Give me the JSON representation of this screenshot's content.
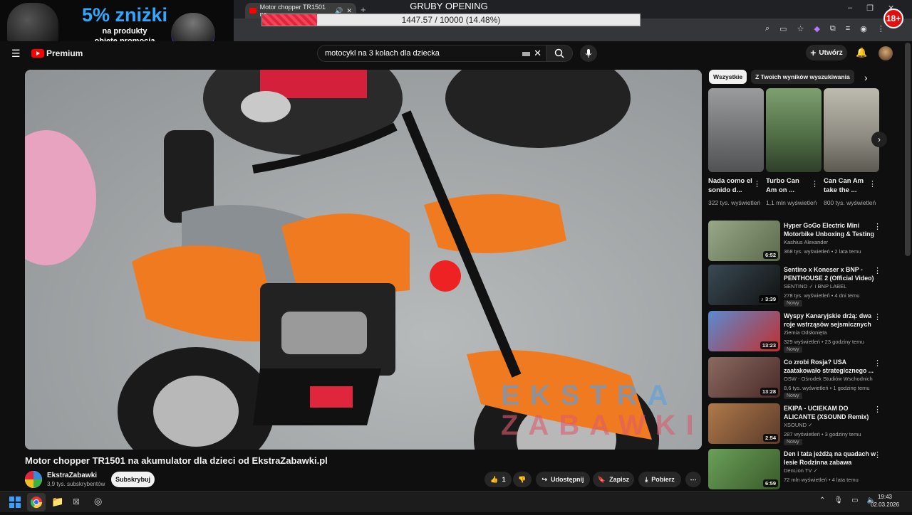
{
  "browser": {
    "tab_title": "Motor chopper TR1501 na",
    "overlay_title": "GRUBY OPENING",
    "progress_text": "1447.57 / 10000 (14.48%)",
    "progress_fraction": 0.1448,
    "badge": "18+",
    "window_controls": [
      "–",
      "❐",
      "✕"
    ]
  },
  "ad": {
    "headline": "5% zniżki",
    "line1": "na produkty",
    "line2": "objęte promocją"
  },
  "youtube": {
    "logo_text": "Premium",
    "search_query": "motocykl na 3 kolach dla dziecka",
    "create_label": "Utwórz"
  },
  "video": {
    "title": "Motor chopper TR1501 na akumulator dla dzieci od EkstraZabawki.pl",
    "watermark_line1": "EKSTRA",
    "watermark_line2": "ZABAWKI",
    "channel": "EkstraZabawki",
    "subscribers": "3,9 tys. subskrybentów",
    "subscribe_label": "Subskrybuj",
    "likes": "1",
    "share_label": "Udostępnij",
    "save_label": "Zapisz",
    "download_label": "Pobierz"
  },
  "chips": [
    "Wszystkie",
    "Z Twoich wyników wyszukiwania"
  ],
  "shorts": [
    {
      "title": "Nada como el sonido d...",
      "views": "322 tys. wyświetleń",
      "thumb_color": "#6d6f70"
    },
    {
      "title": "Turbo Can Am on ...",
      "views": "1,1 mln wyświetleń",
      "thumb_color": "#4e6b44"
    },
    {
      "title": "Can Can Am take the ...",
      "views": "800 tys. wyświetleń",
      "thumb_color": "#8c8a80"
    }
  ],
  "recommendations": [
    {
      "title": "Hyper GoGo Electric Mini Motorbike Unboxing & Testing ...",
      "channel": "Kashius Alexander",
      "meta": "368 tys. wyświetleń • 2 lata temu",
      "duration": "6:52",
      "new": "",
      "thumb_color": "#7a8a6a"
    },
    {
      "title": "Sentino x Koneser x BNP - PENTHOUSE 2 (Official Video)",
      "channel": "SENTINO ✓ i BNP LABEL",
      "meta": "278 tys. wyświetleń • 4 dni temu",
      "duration": "♪ 3:39",
      "new": "Nowy",
      "thumb_color": "#1f2a33"
    },
    {
      "title": "Wyspy Kanaryjskie drżą: dwa roje wstrząsów sejsmicznych i...",
      "channel": "Ziemia Odsłonięta",
      "meta": "329 wyświetleń • 23 godziny temu",
      "duration": "13:23",
      "new": "Nowy",
      "thumb_color": "#3a6aa8"
    },
    {
      "title": "Co zrobi Rosja? USA zaatakowało strategicznego ...",
      "channel": "OSW - Ośrodek Studiów Wschodnich",
      "meta": "8,6 tys. wyświetleń • 1 godzinę temu",
      "duration": "13:28",
      "new": "Nowy",
      "thumb_color": "#6b5048"
    },
    {
      "title": "EKIPA - UCIEKAM DO ALICANTE (XSOUND Remix)",
      "channel": "XSOUND ✓",
      "meta": "287 wyświetleń • 3 godziny temu",
      "duration": "2:54",
      "new": "Nowy",
      "thumb_color": "#8a5a3a"
    },
    {
      "title": "Den i tata jeżdżą na quadach w lesie Rodzinna zabawa",
      "channel": "DenLion TV ✓",
      "meta": "72 mln wyświetleń • 4 lata temu",
      "duration": "6:59",
      "new": "",
      "thumb_color": "#4a7a3a"
    }
  ],
  "taskbar": {
    "time": "19:43",
    "date": "02.03.2026"
  }
}
